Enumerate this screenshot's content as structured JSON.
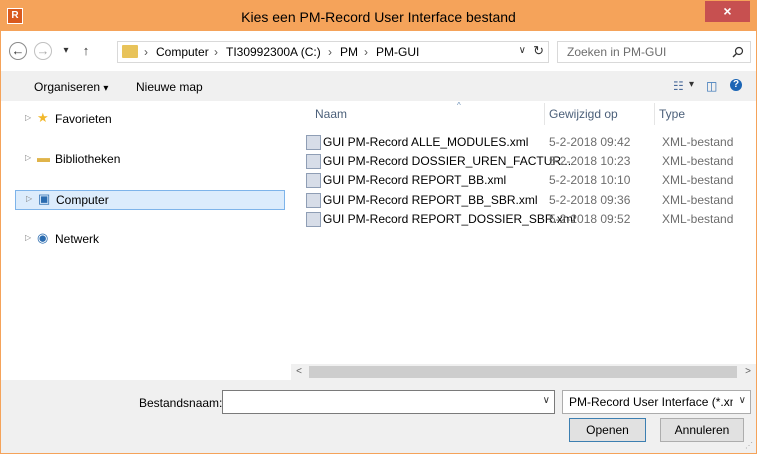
{
  "window": {
    "title": "Kies een PM-Record User Interface bestand",
    "app_icon_letter": "R",
    "close_label": "×",
    "accent_color": "#f5a35a"
  },
  "navbar": {
    "back_icon": "back-arrow-icon",
    "back_glyph": "←",
    "forward_glyph": "→",
    "recent_glyph": "▾",
    "up_glyph": "↑",
    "breadcrumb": [
      "Computer",
      "TI30992300A (C:)",
      "PM",
      "PM-GUI"
    ],
    "separator": "›",
    "refresh_glyph": "↻",
    "search_placeholder": "Zoeken in PM-GUI"
  },
  "toolbar": {
    "organize_label": "Organiseren",
    "organize_caret": "▾",
    "new_folder_label": "Nieuwe map",
    "view_glyph": "☷",
    "view_caret": "▾",
    "preview_glyph": "◫",
    "help_glyph": "?"
  },
  "navpane": {
    "items": [
      {
        "label": "Favorieten",
        "icon": "star-icon",
        "glyph": "★"
      },
      {
        "label": "Bibliotheken",
        "icon": "library-icon",
        "glyph": "▬"
      },
      {
        "label": "Computer",
        "icon": "computer-icon",
        "glyph": "▣"
      },
      {
        "label": "Netwerk",
        "icon": "network-icon",
        "glyph": "◉"
      }
    ],
    "expander_glyph": "▷"
  },
  "files": {
    "columns": {
      "name": "Naam",
      "modified": "Gewijzigd op",
      "type": "Type"
    },
    "sort_glyph": "^",
    "rows": [
      {
        "name": "GUI PM-Record ALLE_MODULES.xml",
        "modified": "5-2-2018 09:42",
        "type": "XML-bestand"
      },
      {
        "name": "GUI PM-Record DOSSIER_UREN_FACTUR...",
        "modified": "5-2-2018 10:23",
        "type": "XML-bestand"
      },
      {
        "name": "GUI PM-Record REPORT_BB.xml",
        "modified": "5-2-2018 10:10",
        "type": "XML-bestand"
      },
      {
        "name": "GUI PM-Record REPORT_BB_SBR.xml",
        "modified": "5-2-2018 09:36",
        "type": "XML-bestand"
      },
      {
        "name": "GUI PM-Record REPORT_DOSSIER_SBR.xml",
        "modified": "5-2-2018 09:52",
        "type": "XML-bestand"
      }
    ]
  },
  "scroll": {
    "left_glyph": "<",
    "right_glyph": ">"
  },
  "bottom": {
    "filename_label": "Bestandsnaam:",
    "filename_value": "",
    "filetype_value": "PM-Record User Interface (*.xm",
    "drop_glyph": "∨",
    "open_label": "Openen",
    "cancel_label": "Annuleren",
    "grip_glyph": "⋰"
  }
}
